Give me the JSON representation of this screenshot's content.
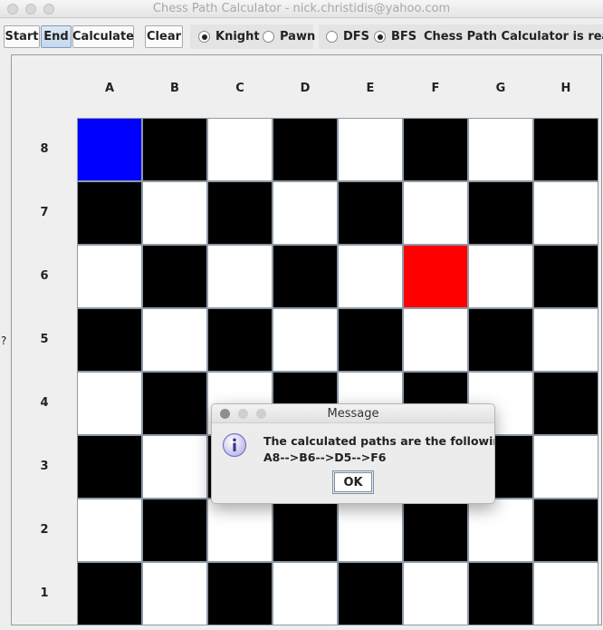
{
  "window": {
    "title": "Chess Path Calculator - nick.christidis@yahoo.com"
  },
  "toolbar": {
    "start_label": "Start",
    "end_label": "End",
    "calculate_label": "Calculate",
    "clear_label": "Clear",
    "piece_options": [
      {
        "label": "Knight",
        "selected": true
      },
      {
        "label": "Pawn",
        "selected": false
      }
    ],
    "algorithm_options": [
      {
        "label": "DFS",
        "selected": false
      },
      {
        "label": "BFS",
        "selected": true
      }
    ],
    "status_text": "Chess Path Calculator is ready!"
  },
  "board": {
    "files": [
      "A",
      "B",
      "C",
      "D",
      "E",
      "F",
      "G",
      "H"
    ],
    "ranks": [
      "8",
      "7",
      "6",
      "5",
      "4",
      "3",
      "2",
      "1"
    ],
    "side_marker": "?",
    "start_square": "A8",
    "end_square": "F6",
    "colors": {
      "dark": "#000000",
      "light": "#ffffff",
      "start": "#0000ff",
      "end": "#ff0000"
    }
  },
  "dialog": {
    "title": "Message",
    "message_line1": "The calculated paths are the following:",
    "message_line2": "A8-->B6-->D5-->F6",
    "ok_label": "OK",
    "icon": "info-icon"
  }
}
